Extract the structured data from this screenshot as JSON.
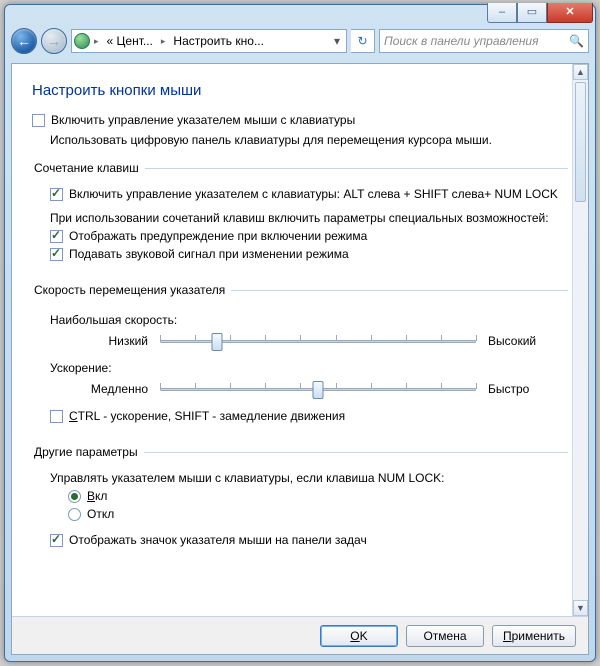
{
  "window": {
    "breadcrumb_seg1": "« Цент...",
    "breadcrumb_seg2": "Настроить кно...",
    "search_placeholder": "Поиск в панели управления"
  },
  "page": {
    "title": "Настроить кнопки мыши",
    "enable_main_label": "Включить управление указателем мыши с клавиатуры",
    "enable_main_desc": "Использовать цифровую панель клавиатуры для перемещения курсора мыши."
  },
  "hotkeys": {
    "legend": "Сочетание клавиш",
    "enable_label": "Включить управление указателем с клавиатуры: ALT слева + SHIFT слева+ NUM LOCK",
    "subhead": "При использовании сочетаний клавиш включить параметры специальных возможностей:",
    "warn_label": "Отображать предупреждение при включении режима",
    "sound_label": "Подавать звуковой сигнал при изменении режима"
  },
  "speed": {
    "legend": "Скорость перемещения указателя",
    "top_speed_label": "Наибольшая скорость:",
    "low": "Низкий",
    "high": "Высокий",
    "accel_label": "Ускорение:",
    "slow": "Медленно",
    "fast": "Быстро",
    "ctrl_shift_label_pre": "",
    "ctrl_shift_label": "CTRL - ускорение, SHIFT - замедление движения"
  },
  "other": {
    "legend": "Другие параметры",
    "numlock_label": "Управлять указателем мыши с клавиатуры, если клавиша NUM LOCK:",
    "on_label": "Вкл",
    "off_label": "Откл",
    "tray_label": "Отображать значок указателя мыши на панели задач"
  },
  "buttons": {
    "ok": "OK",
    "cancel": "Отмена",
    "apply": "Применить"
  },
  "state": {
    "enable_main": false,
    "hk_enable": true,
    "hk_warn": true,
    "hk_sound": true,
    "ctrl_shift": false,
    "numlock_on": true,
    "tray": true,
    "slider_top_speed_pct": 18,
    "slider_accel_pct": 50
  }
}
